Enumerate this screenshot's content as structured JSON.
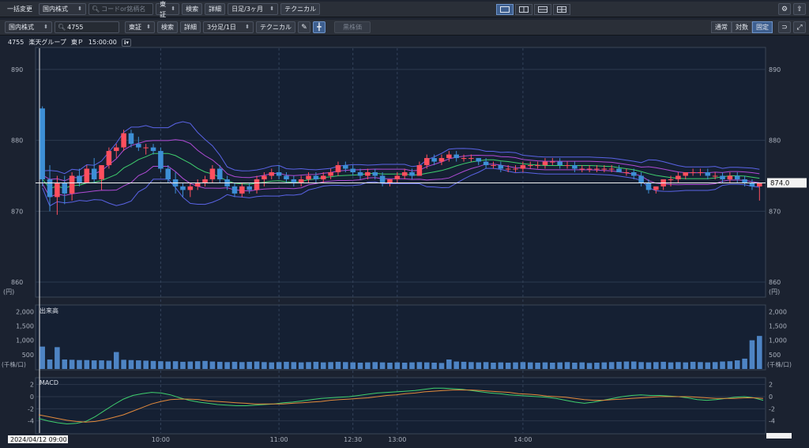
{
  "toolbar1": {
    "bulk_change": "一括変更",
    "market_select": "国内株式",
    "search_placeholder": "コードor銘柄名",
    "exchange_select": "東証",
    "search_btn": "検索",
    "detail_btn": "詳細",
    "period_select": "日足/3ヶ月",
    "technical_btn": "テクニカル"
  },
  "toolbar2": {
    "market_select": "国内株式",
    "search_value": "4755",
    "exchange_select": "東証",
    "search_btn": "検索",
    "detail_btn": "詳細",
    "period_select": "3分足/1日",
    "technical_btn": "テクニカル",
    "unknown_btn": "黒株価",
    "scale_normal": "通常",
    "scale_log": "対数",
    "scale_fixed": "固定",
    "active_scale": "固定"
  },
  "stock": {
    "code": "4755",
    "name": "楽天グループ",
    "market": "東Ｐ",
    "time": "15:00:00"
  },
  "price_panel": {
    "y_ticks": [
      "890",
      "880",
      "870",
      "860"
    ],
    "unit": "(円)",
    "current_price": "874.0"
  },
  "volume_panel": {
    "label": "出来高",
    "y_ticks": [
      "2,000",
      "1,500",
      "1,000",
      "500"
    ],
    "unit": "(千株/口)"
  },
  "macd_panel": {
    "label": "MACD",
    "y_ticks": [
      "2",
      "0",
      "-2",
      "-4"
    ]
  },
  "x_axis": {
    "labels": [
      "10:00",
      "11:00",
      "12:30",
      "13:00",
      "14:00"
    ],
    "cursor_label": "2024/04/12 09:00"
  },
  "colors": {
    "up": "#ff4f5e",
    "down": "#3d8fd6",
    "volume": "#4e84c4",
    "bb_outer": "#5a63e6",
    "bb_inner": "#b04bd6",
    "ma": "#3fcf6e",
    "macd": "#3fcf6e",
    "signal": "#e38a3c"
  },
  "chart_data": {
    "type": "candlestick",
    "ylim": [
      858,
      893
    ],
    "volume_ylim": [
      0,
      2200
    ],
    "macd_ylim": [
      -6,
      3
    ],
    "candles": [
      [
        884.5,
        884.8,
        873.5,
        874.5
      ],
      [
        874.5,
        876.5,
        870.0,
        872.0
      ],
      [
        872.0,
        875.0,
        869.5,
        874.0
      ],
      [
        874.0,
        875.0,
        871.0,
        872.5
      ],
      [
        872.5,
        875.5,
        871.5,
        875.0
      ],
      [
        875.0,
        876.0,
        873.5,
        874.0
      ],
      [
        874.0,
        876.5,
        874.0,
        876.0
      ],
      [
        876.0,
        877.5,
        874.0,
        874.5
      ],
      [
        874.5,
        876.5,
        873.0,
        876.5
      ],
      [
        876.5,
        879.0,
        876.0,
        878.5
      ],
      [
        878.5,
        879.5,
        877.5,
        879.0
      ],
      [
        879.0,
        881.5,
        878.5,
        881.0
      ],
      [
        881.0,
        881.5,
        879.0,
        879.5
      ],
      [
        879.5,
        880.5,
        878.5,
        879.0
      ],
      [
        879.0,
        879.5,
        878.0,
        879.0
      ],
      [
        879.0,
        879.5,
        878.0,
        878.5
      ],
      [
        878.5,
        879.0,
        875.5,
        876.0
      ],
      [
        876.0,
        876.5,
        874.0,
        874.5
      ],
      [
        874.5,
        875.5,
        872.5,
        873.5
      ],
      [
        873.5,
        874.0,
        872.0,
        873.0
      ],
      [
        873.0,
        874.0,
        872.0,
        873.5
      ],
      [
        873.5,
        874.5,
        873.0,
        874.0
      ],
      [
        874.0,
        875.0,
        873.5,
        874.5
      ],
      [
        874.5,
        876.5,
        874.0,
        876.0
      ],
      [
        876.0,
        876.5,
        874.0,
        874.5
      ],
      [
        874.5,
        875.0,
        873.0,
        873.5
      ],
      [
        873.5,
        874.0,
        872.0,
        872.5
      ],
      [
        872.5,
        874.0,
        872.0,
        873.5
      ],
      [
        873.5,
        874.0,
        872.5,
        873.0
      ],
      [
        873.0,
        875.0,
        872.5,
        874.5
      ],
      [
        874.5,
        875.5,
        873.5,
        875.0
      ],
      [
        875.0,
        876.0,
        874.5,
        875.5
      ],
      [
        875.5,
        876.5,
        874.5,
        875.0
      ],
      [
        875.0,
        875.5,
        874.0,
        874.5
      ],
      [
        874.5,
        875.0,
        873.5,
        874.0
      ],
      [
        874.0,
        875.0,
        873.5,
        874.5
      ],
      [
        874.5,
        875.5,
        874.0,
        875.0
      ],
      [
        875.0,
        875.5,
        874.0,
        874.5
      ],
      [
        874.5,
        875.5,
        874.0,
        875.0
      ],
      [
        875.0,
        876.0,
        874.5,
        875.5
      ],
      [
        875.5,
        877.0,
        875.0,
        876.5
      ],
      [
        876.5,
        877.0,
        875.5,
        876.0
      ],
      [
        876.0,
        876.5,
        875.0,
        875.5
      ],
      [
        875.5,
        876.0,
        874.5,
        875.0
      ],
      [
        875.0,
        876.0,
        874.5,
        875.5
      ],
      [
        875.5,
        876.0,
        874.5,
        875.0
      ],
      [
        875.0,
        875.5,
        873.5,
        874.0
      ],
      [
        874.0,
        874.5,
        873.5,
        874.5
      ],
      [
        874.5,
        875.5,
        874.0,
        875.0
      ],
      [
        875.0,
        876.0,
        874.5,
        875.5
      ],
      [
        875.5,
        876.0,
        874.5,
        875.0
      ],
      [
        875.0,
        877.0,
        875.0,
        876.5
      ],
      [
        876.5,
        878.0,
        876.0,
        877.5
      ],
      [
        877.5,
        878.0,
        876.5,
        877.0
      ],
      [
        877.0,
        878.0,
        876.5,
        877.5
      ],
      [
        877.5,
        878.5,
        877.0,
        878.0
      ],
      [
        878.0,
        878.5,
        877.0,
        877.5
      ],
      [
        877.5,
        878.0,
        877.0,
        877.5
      ],
      [
        877.5,
        878.0,
        877.0,
        877.5
      ],
      [
        877.5,
        877.5,
        876.5,
        877.0
      ],
      [
        877.0,
        877.5,
        876.0,
        876.5
      ],
      [
        876.5,
        877.0,
        876.0,
        876.5
      ],
      [
        876.5,
        877.0,
        875.5,
        876.0
      ],
      [
        876.0,
        876.5,
        875.5,
        876.0
      ],
      [
        876.0,
        876.5,
        875.5,
        876.0
      ],
      [
        876.0,
        877.0,
        875.5,
        876.5
      ],
      [
        876.5,
        877.0,
        876.0,
        876.5
      ],
      [
        876.5,
        877.0,
        876.0,
        876.5
      ],
      [
        876.5,
        877.5,
        876.0,
        877.0
      ],
      [
        877.0,
        877.5,
        876.5,
        877.0
      ],
      [
        877.0,
        877.5,
        876.0,
        876.5
      ],
      [
        876.5,
        877.0,
        876.0,
        876.5
      ],
      [
        876.5,
        877.0,
        875.5,
        876.0
      ],
      [
        876.0,
        876.5,
        875.5,
        876.0
      ],
      [
        876.0,
        876.5,
        875.5,
        876.0
      ],
      [
        876.0,
        876.5,
        875.5,
        876.0
      ],
      [
        876.0,
        876.5,
        875.5,
        876.0
      ],
      [
        876.0,
        876.5,
        875.5,
        876.0
      ],
      [
        876.0,
        876.5,
        875.5,
        875.5
      ],
      [
        875.5,
        876.0,
        875.0,
        875.5
      ],
      [
        875.5,
        876.0,
        874.5,
        875.0
      ],
      [
        875.0,
        875.5,
        873.5,
        874.0
      ],
      [
        874.0,
        874.5,
        872.5,
        873.0
      ],
      [
        873.0,
        873.5,
        872.5,
        873.5
      ],
      [
        873.5,
        874.5,
        873.0,
        874.5
      ],
      [
        874.5,
        875.0,
        873.5,
        874.5
      ],
      [
        874.5,
        875.5,
        874.0,
        875.0
      ],
      [
        875.0,
        875.5,
        874.5,
        875.5
      ],
      [
        875.5,
        876.0,
        875.0,
        875.5
      ],
      [
        875.5,
        876.0,
        875.0,
        875.5
      ],
      [
        875.5,
        876.0,
        874.5,
        875.0
      ],
      [
        875.0,
        875.5,
        874.5,
        875.0
      ],
      [
        875.0,
        875.5,
        874.0,
        874.5
      ],
      [
        874.5,
        875.5,
        874.0,
        875.0
      ],
      [
        875.0,
        875.5,
        874.0,
        874.5
      ],
      [
        874.5,
        875.0,
        873.5,
        874.0
      ],
      [
        874.0,
        874.5,
        873.0,
        873.5
      ],
      [
        873.5,
        874.0,
        871.5,
        874.0
      ]
    ],
    "volume": [
      780,
      330,
      760,
      330,
      320,
      310,
      310,
      300,
      300,
      290,
      590,
      320,
      310,
      300,
      290,
      280,
      270,
      260,
      270,
      250,
      260,
      270,
      280,
      260,
      250,
      240,
      250,
      240,
      250,
      260,
      240,
      230,
      240,
      250,
      240,
      230,
      240,
      250,
      230,
      240,
      250,
      240,
      230,
      220,
      230,
      240,
      230,
      220,
      230,
      220,
      230,
      240,
      230,
      220,
      210,
      330,
      260,
      250,
      240,
      230,
      240,
      220,
      230,
      220,
      230,
      240,
      230,
      220,
      230,
      220,
      230,
      240,
      220,
      230,
      210,
      220,
      230,
      240,
      250,
      260,
      260,
      240,
      230,
      240,
      250,
      230,
      240,
      230,
      250,
      240,
      230,
      240,
      260,
      270,
      300,
      360,
      1000,
      1150
    ],
    "macd": [
      -3.6,
      -4.0,
      -4.3,
      -4.5,
      -4.4,
      -4.1,
      -3.3,
      -2.3,
      -1.3,
      -0.4,
      0.2,
      0.5,
      0.7,
      0.6,
      0.3,
      -0.2,
      -0.6,
      -0.9,
      -1.1,
      -1.3,
      -1.4,
      -1.5,
      -1.5,
      -1.4,
      -1.3,
      -1.2,
      -1.0,
      -0.9,
      -0.7,
      -0.5,
      -0.3,
      -0.2,
      -0.1,
      0.0,
      0.2,
      0.4,
      0.6,
      0.7,
      0.8,
      0.9,
      1.0,
      1.2,
      1.4,
      1.4,
      1.3,
      1.2,
      1.0,
      0.8,
      0.6,
      0.5,
      0.3,
      0.2,
      0.1,
      0.0,
      -0.1,
      -0.3,
      -0.6,
      -0.9,
      -1.1,
      -0.9,
      -0.6,
      -0.3,
      0.0,
      0.2,
      0.3,
      0.2,
      0.2,
      0.1,
      0.0,
      -0.2,
      -0.5,
      -0.6,
      -0.5,
      -0.3,
      -0.1,
      0.0,
      -0.2,
      -0.6
    ],
    "signal": [
      -3.0,
      -3.3,
      -3.6,
      -3.9,
      -4.1,
      -4.2,
      -4.1,
      -3.8,
      -3.4,
      -3.0,
      -2.4,
      -1.8,
      -1.2,
      -0.8,
      -0.5,
      -0.4,
      -0.4,
      -0.5,
      -0.7,
      -0.8,
      -0.9,
      -1.0,
      -1.1,
      -1.2,
      -1.2,
      -1.2,
      -1.2,
      -1.1,
      -1.0,
      -0.9,
      -0.8,
      -0.6,
      -0.5,
      -0.4,
      -0.3,
      -0.2,
      0.0,
      0.2,
      0.3,
      0.5,
      0.6,
      0.8,
      0.9,
      1.0,
      1.1,
      1.1,
      1.1,
      1.0,
      0.9,
      0.8,
      0.7,
      0.5,
      0.4,
      0.3,
      0.1,
      0.0,
      -0.1,
      -0.3,
      -0.5,
      -0.6,
      -0.6,
      -0.5,
      -0.4,
      -0.3,
      -0.2,
      -0.1,
      0.0,
      0.0,
      0.0,
      0.0,
      -0.1,
      -0.2,
      -0.3,
      -0.3,
      -0.3,
      -0.2,
      -0.2,
      -0.3
    ]
  }
}
